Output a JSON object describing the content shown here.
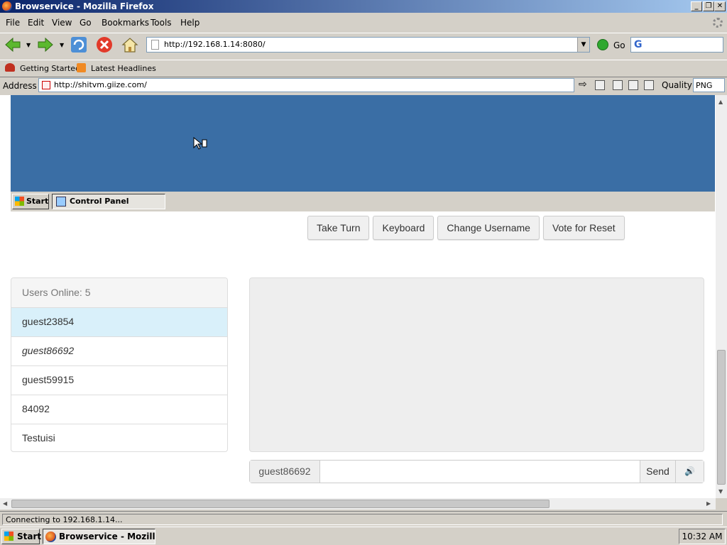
{
  "window": {
    "title": "Browservice - Mozilla Firefox"
  },
  "menu": [
    "File",
    "Edit",
    "View",
    "Go",
    "Bookmarks",
    "Tools",
    "Help"
  ],
  "nav": {
    "url": "http://192.168.1.14:8080/",
    "go_label": "Go"
  },
  "bookmarks": [
    "Getting Started",
    "Latest Headlines"
  ],
  "inner": {
    "address_label": "Address",
    "address_url": "http://shitvm.giize.com/",
    "quality_label": "Quality",
    "quality_value": "PNG"
  },
  "vm": {
    "start_label": "Start",
    "task_label": "Control Panel"
  },
  "buttons": [
    "Take Turn",
    "Keyboard",
    "Change Username",
    "Vote for Reset"
  ],
  "users": {
    "header": "Users Online: 5",
    "list": [
      "guest23854",
      "guest86692",
      "guest59915",
      "84092",
      "Testuisi"
    ]
  },
  "chat": {
    "username": "guest86692",
    "input_value": "",
    "send_label": "Send"
  },
  "status": {
    "text": "Connecting to 192.168.1.14..."
  },
  "taskbar": {
    "start_label": "Start",
    "task_label": "Browservice - Mozilla...",
    "clock": "10:32 AM"
  }
}
